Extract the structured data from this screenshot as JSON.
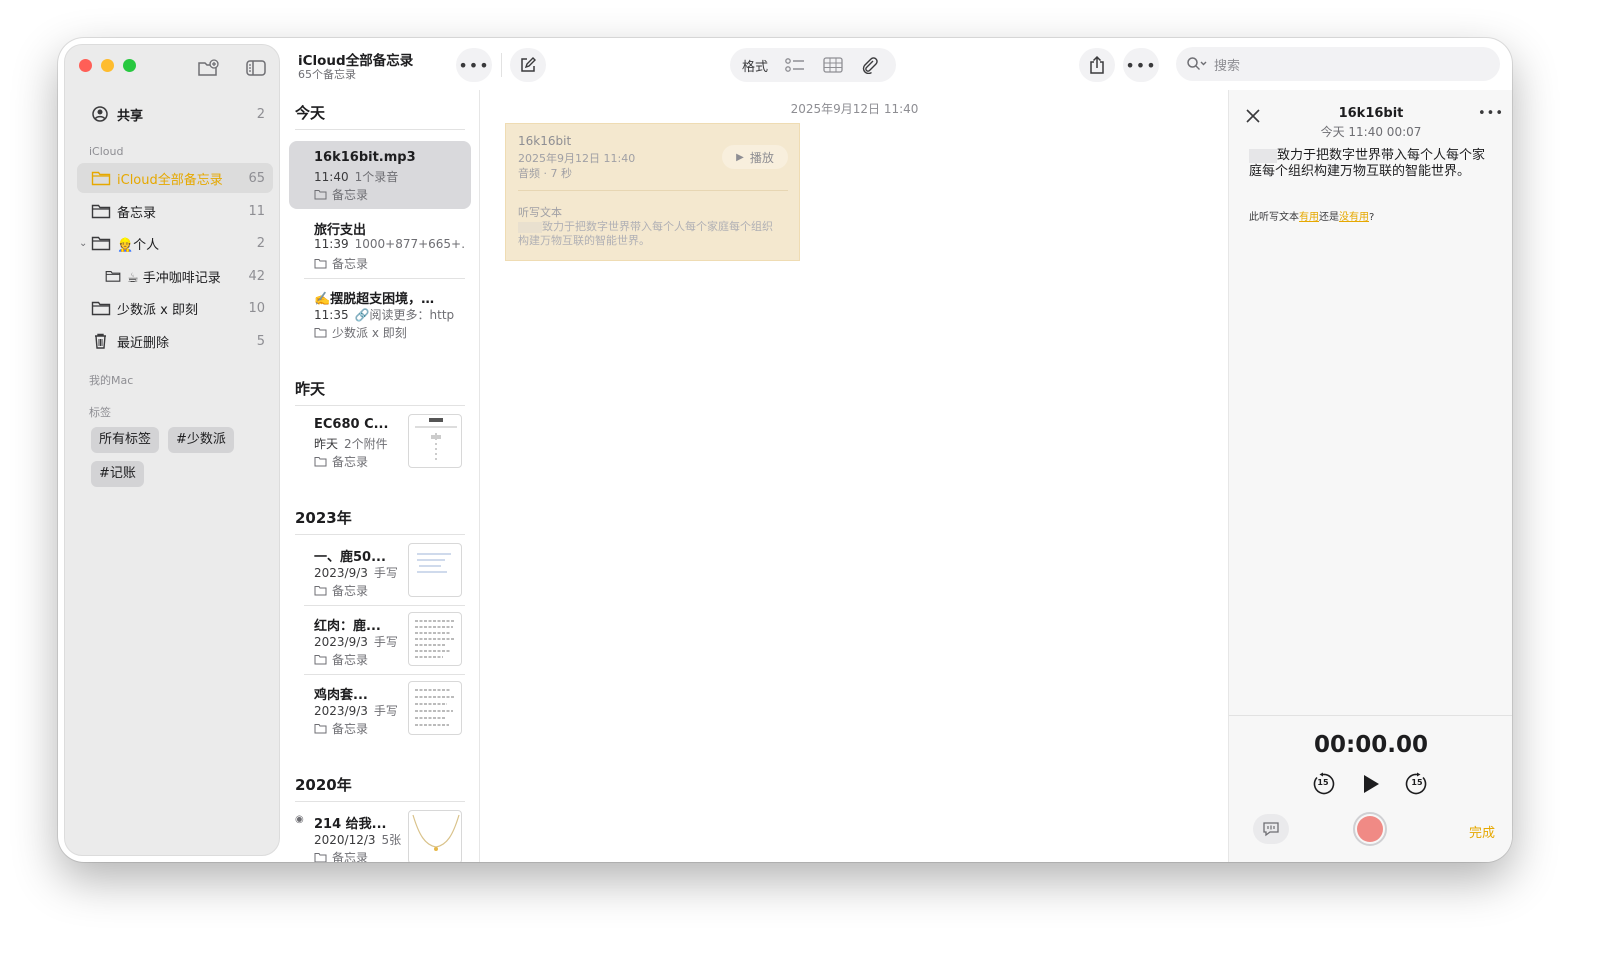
{
  "toolbar": {
    "title": "iCloud全部备忘录",
    "subtitle": "65个备忘录",
    "format_label": "格式",
    "search_placeholder": "搜索"
  },
  "sidebar": {
    "shared": {
      "label": "共享",
      "count": "2"
    },
    "icloud_header": "iCloud",
    "items": [
      {
        "label": "iCloud全部备忘录",
        "count": "65",
        "selected": true
      },
      {
        "label": "备忘录",
        "count": "11"
      },
      {
        "label": "👷个人",
        "count": "2"
      },
      {
        "label": "☕ 手冲咖啡记录",
        "count": "42"
      },
      {
        "label": "少数派 x 即刻",
        "count": "10"
      },
      {
        "label": "最近删除",
        "count": "5"
      }
    ],
    "mac_header": "我的Mac",
    "tags_header": "标签",
    "tags": [
      "所有标签",
      "#少数派",
      "#记账"
    ]
  },
  "notes": {
    "sections": [
      "今天",
      "昨天",
      "2023年",
      "2020年"
    ],
    "items": [
      {
        "title": "16k16bit.mp3",
        "time": "11:40",
        "preview": "1个录音",
        "folder": "备忘录"
      },
      {
        "title": "旅行支出",
        "time": "11:39",
        "preview": "1000+877+665+…",
        "folder": "备忘录"
      },
      {
        "title": "✍️摆脱超支困境，…",
        "time": "11:35",
        "preview": "🔗阅读更多：http",
        "folder": "少数派 x 即刻"
      },
      {
        "title": "EC680 C...",
        "time": "昨天",
        "preview": "2个附件",
        "folder": "备忘录"
      },
      {
        "title": "一、鹿50...",
        "time": "2023/9/3",
        "preview": "手写",
        "folder": "备忘录"
      },
      {
        "title": "红肉：鹿...",
        "time": "2023/9/3",
        "preview": "手写",
        "folder": "备忘录"
      },
      {
        "title": "鸡肉套...",
        "time": "2023/9/3",
        "preview": "手写",
        "folder": "备忘录"
      },
      {
        "title": "214 给我...",
        "time": "2020/12/3",
        "preview": "5张",
        "folder": "备忘录"
      }
    ]
  },
  "editor": {
    "date": "2025年9月12日 11:40",
    "card": {
      "title": "16k16bit",
      "date": "2025年9月12日 11:40",
      "sub": "音频 · 7 秒",
      "play_label": "播放",
      "transcript_label": "听写文本",
      "transcript": "致力于把数字世界带入每个人每个家庭每个组织构建万物互联的智能世界。"
    }
  },
  "panel": {
    "title": "16k16bit",
    "subtitle": "今天 11:40   00:07",
    "text": "致力于把数字世界带入每个人每个家庭每个组织构建万物互联的智能世界。",
    "feedback_prefix": "此听写文本",
    "feedback_useful": "有用",
    "feedback_mid": "还是",
    "feedback_useless": "没有用",
    "feedback_suffix": "?",
    "timer": "00:00.00",
    "skip_back": "15",
    "skip_forward": "15",
    "done_label": "完成"
  },
  "colors": {
    "accent": "#e6a800",
    "close": "#ff5f57",
    "minimize": "#febc2e",
    "zoom": "#28c840",
    "record": "#f08a85"
  }
}
